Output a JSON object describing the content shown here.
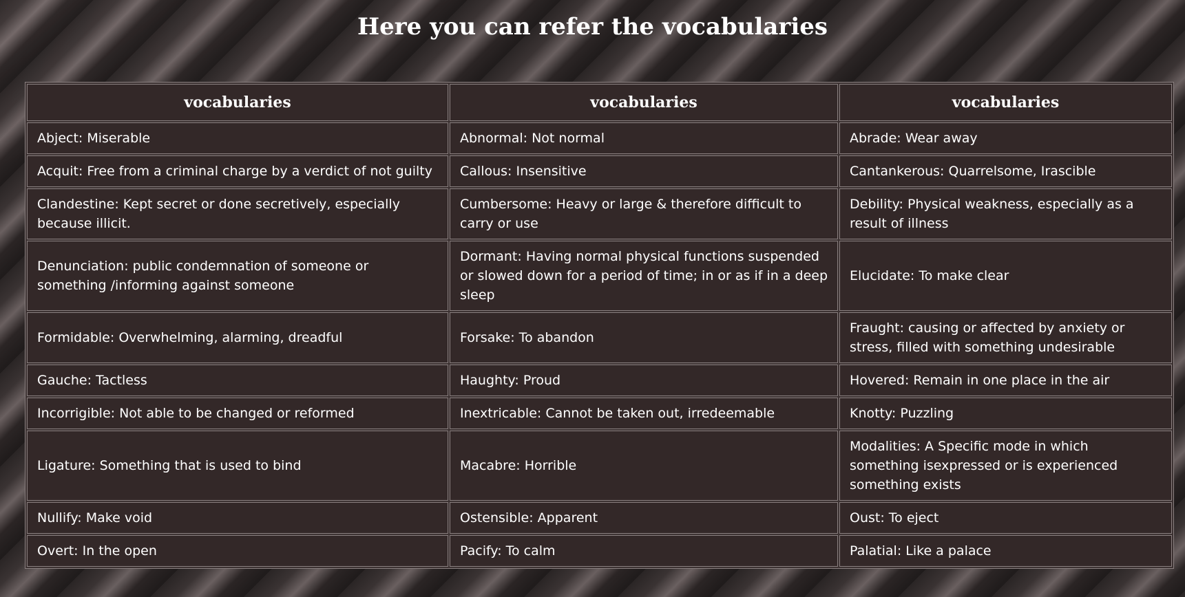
{
  "page": {
    "title": "Here you can refer the vocabularies"
  },
  "table": {
    "headers": [
      "vocabularies",
      "vocabularies",
      "vocabularies"
    ],
    "rows": [
      [
        "Abject: Miserable",
        "Abnormal: Not normal",
        "Abrade: Wear away"
      ],
      [
        "Acquit: Free from a criminal charge by a verdict of not guilty",
        "Callous: Insensitive",
        "Cantankerous: Quarrelsome, Irascible"
      ],
      [
        "Clandestine: Kept secret or done secretively, especially because illicit.",
        "Cumbersome: Heavy or large & therefore difficult to carry or use",
        "Debility: Physical weakness, especially as a result of illness"
      ],
      [
        "Denunciation: public condemnation of someone or something /informing against someone",
        "Dormant: Having normal physical functions suspended or slowed down for a period of time; in or as if in a deep sleep",
        "Elucidate: To make clear"
      ],
      [
        "Formidable: Overwhelming, alarming, dreadful",
        "Forsake: To abandon",
        "Fraught: causing or affected by anxiety or stress, filled with something undesirable"
      ],
      [
        "Gauche: Tactless",
        "Haughty: Proud",
        "Hovered: Remain in one place in the air"
      ],
      [
        "Incorrigible: Not able to be changed or reformed",
        "Inextricable: Cannot be taken out, irredeemable",
        "Knotty: Puzzling"
      ],
      [
        "Ligature: Something that is used to bind",
        "Macabre: Horrible",
        "Modalities: A Specific mode in which something isexpressed or is experienced something exists"
      ],
      [
        "Nullify: Make void",
        "Ostensible: Apparent",
        "Oust: To eject"
      ],
      [
        "Overt: In the open",
        "Pacify: To calm",
        "Palatial: Like a palace"
      ]
    ]
  }
}
